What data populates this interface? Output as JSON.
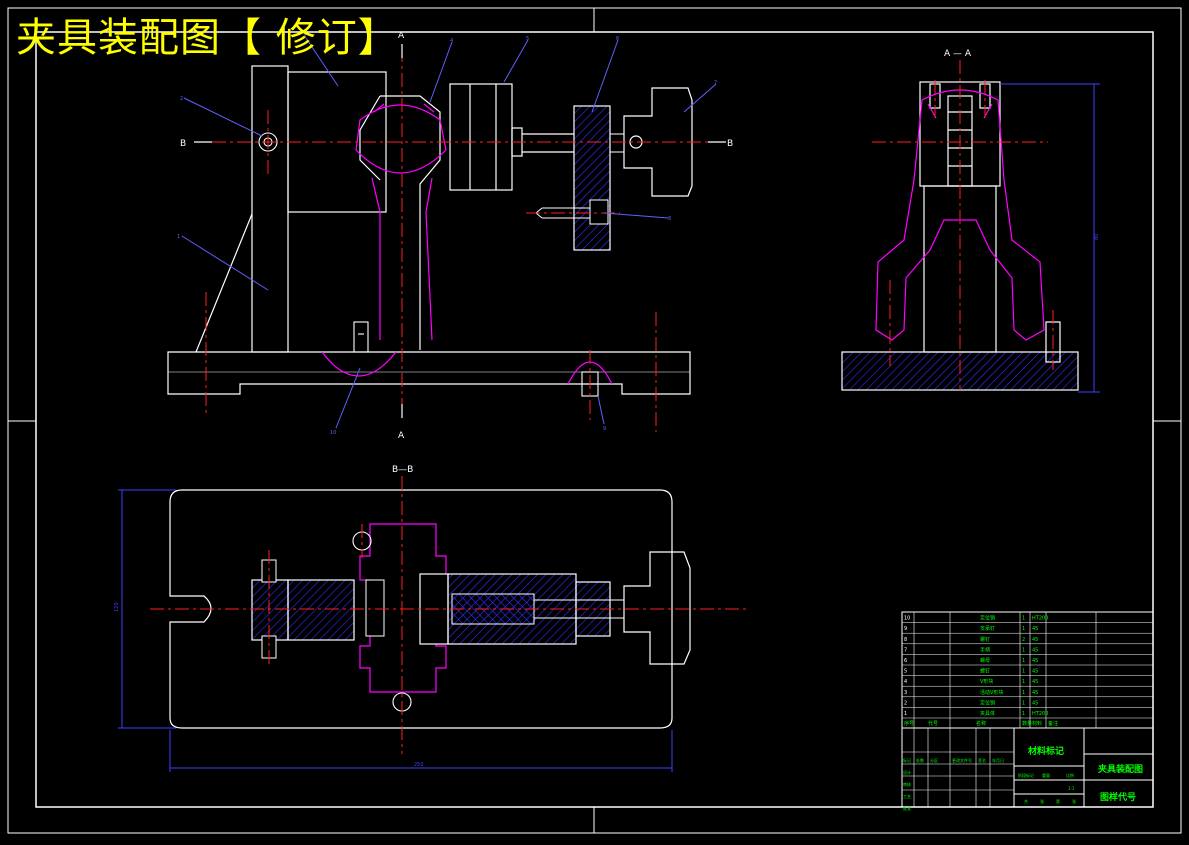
{
  "title": "夹具装配图【 修订】",
  "section_labels": {
    "a_top": "A",
    "a_bottom": "A",
    "b_left": "B",
    "b_right": "B",
    "side_view": "A — A",
    "plan_view": "B—B"
  },
  "balloons": [
    "1",
    "2",
    "3",
    "4",
    "5",
    "6",
    "7",
    "8",
    "9",
    "10"
  ],
  "dimensions": {
    "side_height": "80",
    "plan_height": "120",
    "plan_width": "250"
  },
  "title_block": {
    "part_name": "夹具装配图",
    "drawing_no_label": "图样代号",
    "material_label": "材料标记",
    "header_cols": [
      "序号",
      "代号",
      "名称",
      "数量",
      "材料",
      "备注"
    ],
    "bom_rows": [
      [
        "10",
        "",
        "定位销",
        "1",
        "HT200",
        ""
      ],
      [
        "9",
        "",
        "支承钉",
        "1",
        "45",
        ""
      ],
      [
        "8",
        "",
        "螺钉",
        "2",
        "45",
        ""
      ],
      [
        "7",
        "",
        "手柄",
        "1",
        "45",
        ""
      ],
      [
        "6",
        "",
        "螺母",
        "1",
        "45",
        ""
      ],
      [
        "5",
        "",
        "螺钉",
        "1",
        "45",
        ""
      ],
      [
        "4",
        "",
        "V形块",
        "1",
        "45",
        ""
      ],
      [
        "3",
        "",
        "活动V形块",
        "1",
        "45",
        ""
      ],
      [
        "2",
        "",
        "定位销",
        "1",
        "45",
        ""
      ],
      [
        "1",
        "",
        "夹具体",
        "1",
        "HT200",
        ""
      ]
    ],
    "rev_cols": [
      "标记",
      "处数",
      "分区",
      "更改文件号",
      "签名",
      "年月日"
    ],
    "sign_rows": [
      "设计",
      "审核",
      "工艺",
      "批准"
    ],
    "stage_labels": [
      "阶段标记",
      "重量",
      "比例"
    ],
    "scale": "1:1",
    "sheet_labels": [
      "共",
      "张",
      "第",
      "张"
    ]
  },
  "colors": {
    "part_line": "#ffffff",
    "center_line": "#ff2020",
    "workpiece": "#ff00ff",
    "hatch": "#3030ff",
    "dimension": "#4040ff",
    "balloon": "#6060ff",
    "table_text": "#00ff00",
    "title_text": "#ffff00"
  }
}
